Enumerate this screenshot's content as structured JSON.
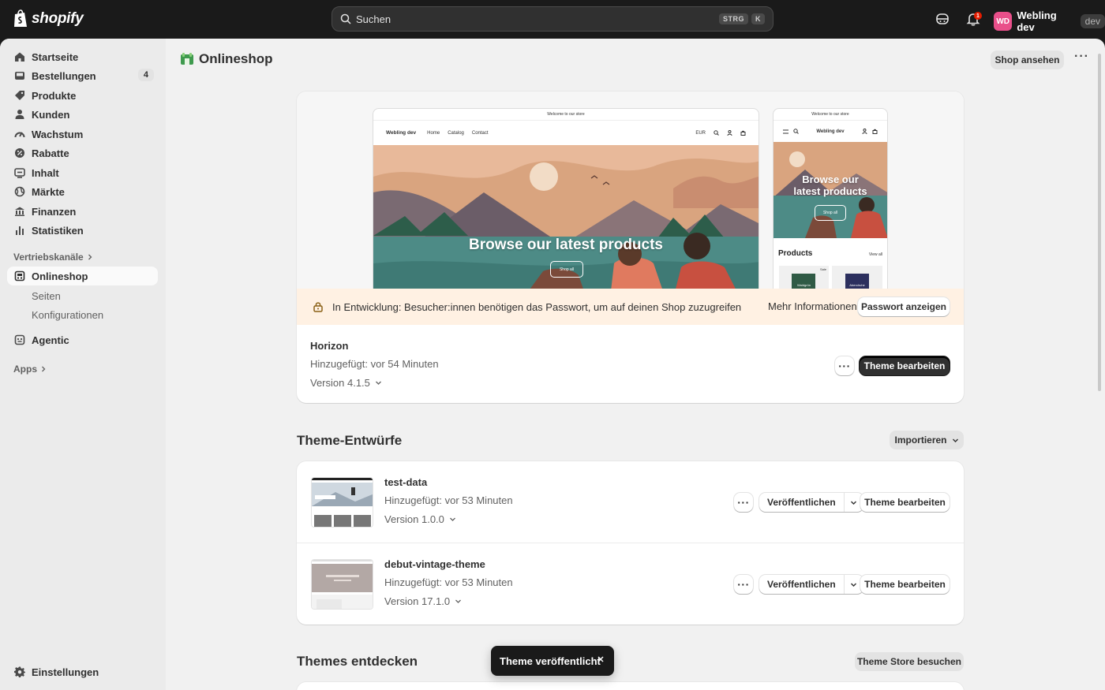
{
  "topbar": {
    "brand": "shopify",
    "search_placeholder": "Suchen",
    "shortcut_mod": "STRG",
    "shortcut_key": "K",
    "notification_count": "1",
    "account_initials": "WD",
    "account_name": "Webling dev",
    "account_badge": "dev"
  },
  "sidebar": {
    "items": [
      {
        "label": "Startseite",
        "icon": "home-icon"
      },
      {
        "label": "Bestellungen",
        "icon": "orders-icon",
        "count": "4"
      },
      {
        "label": "Produkte",
        "icon": "tag-icon"
      },
      {
        "label": "Kunden",
        "icon": "person-icon"
      },
      {
        "label": "Wachstum",
        "icon": "gauge-icon"
      },
      {
        "label": "Rabatte",
        "icon": "discount-icon"
      },
      {
        "label": "Inhalt",
        "icon": "content-icon"
      },
      {
        "label": "Märkte",
        "icon": "globe-icon"
      },
      {
        "label": "Finanzen",
        "icon": "bank-icon"
      },
      {
        "label": "Statistiken",
        "icon": "chart-icon"
      }
    ],
    "sales_channels_label": "Vertriebskanäle",
    "online_store": "Onlineshop",
    "online_store_sub": [
      "Seiten",
      "Konfigurationen"
    ],
    "agentic": "Agentic",
    "apps_label": "Apps",
    "settings": "Einstellungen"
  },
  "page": {
    "title": "Onlineshop",
    "view_shop": "Shop ansehen"
  },
  "preview": {
    "announcement": "Welcome to our store",
    "store_name": "Webling dev",
    "nav_links": [
      "Home",
      "Catalog",
      "Contact"
    ],
    "currency": "EUR",
    "hero_title": "Browse our latest products",
    "hero_title_mobile_1": "Browse our",
    "hero_title_mobile_2": "latest products",
    "hero_button": "Shop all",
    "products_heading": "Products",
    "view_all": "View all",
    "sale_badge": "Sale",
    "product_1": "Waldgrün",
    "product_2": "Abendruhe"
  },
  "banner": {
    "message": "In Entwicklung: Besucher:innen benötigen das Passwort, um auf deinen Shop zuzugreifen",
    "more_info": "Mehr Informationen",
    "show_password": "Passwort anzeigen"
  },
  "current_theme": {
    "name": "Horizon",
    "added": "Hinzugefügt: vor 54 Minuten",
    "version": "Version 4.1.5",
    "edit": "Theme bearbeiten"
  },
  "drafts": {
    "title": "Theme-Entwürfe",
    "import": "Importieren",
    "items": [
      {
        "name": "test-data",
        "added": "Hinzugefügt: vor 53 Minuten",
        "version": "Version 1.0.0",
        "publish": "Veröffentlichen",
        "edit": "Theme bearbeiten"
      },
      {
        "name": "debut-vintage-theme",
        "added": "Hinzugefügt: vor 53 Minuten",
        "version": "Version 17.1.0",
        "publish": "Veröffentlichen",
        "edit": "Theme bearbeiten"
      }
    ]
  },
  "discover": {
    "title": "Themes entdecken",
    "visit_store": "Theme Store besuchen"
  },
  "toast": {
    "message": "Theme veröffentlicht"
  },
  "colors": {
    "topbar": "#1a1a1a",
    "banner": "#fff1e3",
    "primary_button": "#303030",
    "avatar": "#e94f8a",
    "notification": "#e51c00"
  }
}
